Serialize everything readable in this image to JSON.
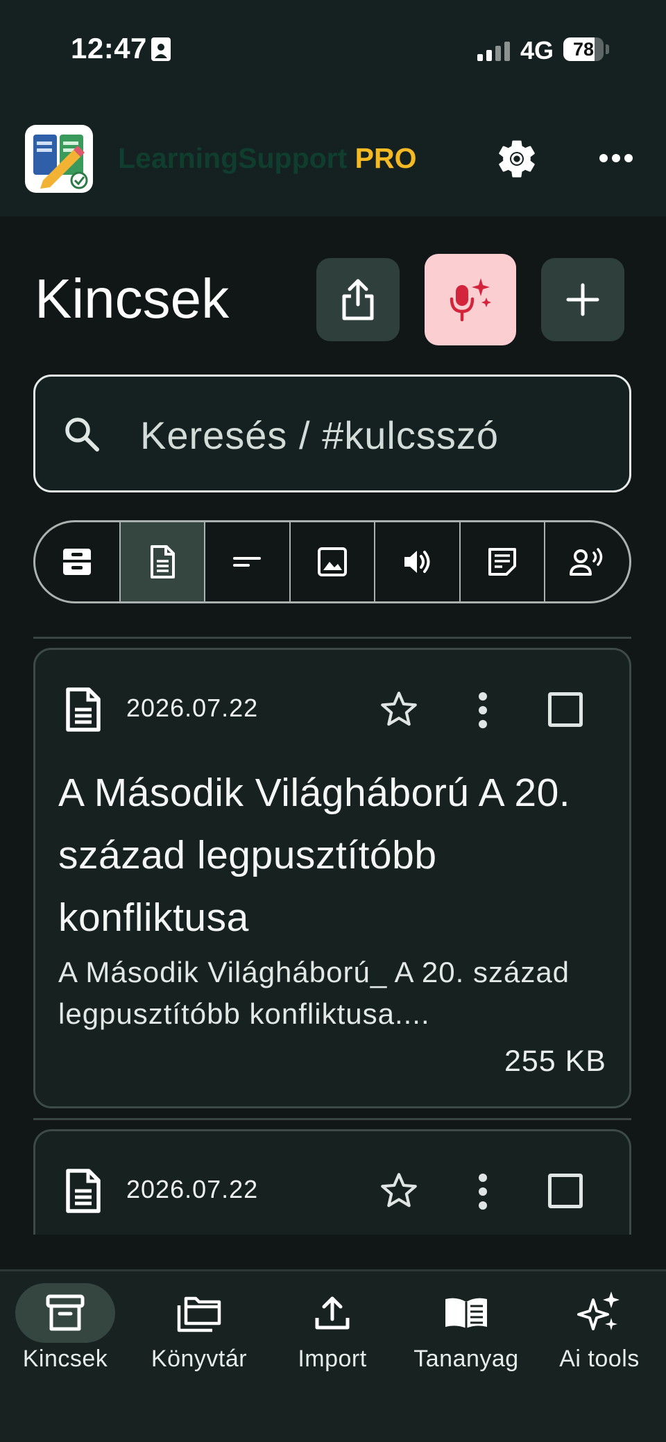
{
  "status_bar": {
    "time": "12:47",
    "network": "4G",
    "battery": "78"
  },
  "app": {
    "name": "LearningSupport",
    "badge": "PRO",
    "colors": {
      "name": "#0f3d2e",
      "badge": "#f5b924"
    }
  },
  "header_icons": {
    "settings": "gear-icon",
    "more": "more-horizontal-icon"
  },
  "page": {
    "title": "Kincsek"
  },
  "actions": {
    "share": "share-icon",
    "voice": "mic-sparkle-icon",
    "add": "plus-icon",
    "voice_bg": "#fbcfd2"
  },
  "search": {
    "placeholder": "Keresés / #kulcsszó"
  },
  "filters": [
    {
      "icon": "archive-icon",
      "active": false
    },
    {
      "icon": "document-icon",
      "active": true
    },
    {
      "icon": "text-short-icon",
      "active": false
    },
    {
      "icon": "image-icon",
      "active": false
    },
    {
      "icon": "volume-icon",
      "active": false
    },
    {
      "icon": "note-icon",
      "active": false
    },
    {
      "icon": "voice-person-icon",
      "active": false
    }
  ],
  "items": [
    {
      "date": "2026.07.22",
      "title": "A Második Világháború  A 20. század legpusztítóbb konfliktusa",
      "description": "A Második Világháború_ A 20. század legpusztítóbb konfliktusa....",
      "size": "255 KB",
      "starred": false,
      "checked": false
    },
    {
      "date": "2026.07.22",
      "starred": false,
      "checked": false
    }
  ],
  "nav": [
    {
      "label": "Kincsek",
      "icon": "archive-icon",
      "active": true
    },
    {
      "label": "Könyvtár",
      "icon": "folders-icon",
      "active": false
    },
    {
      "label": "Import",
      "icon": "upload-icon",
      "active": false
    },
    {
      "label": "Tananyag",
      "icon": "open-book-icon",
      "active": false
    },
    {
      "label": "Ai tools",
      "icon": "sparkles-icon",
      "active": false
    }
  ]
}
